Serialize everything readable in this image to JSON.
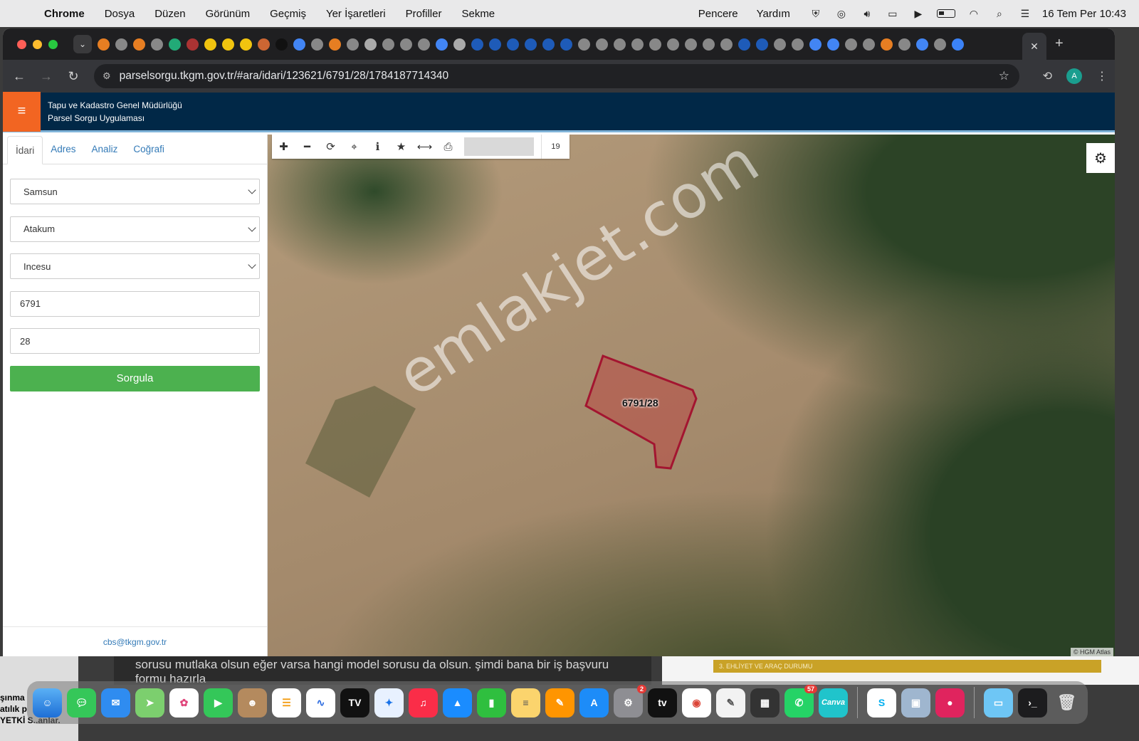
{
  "menubar": {
    "app_name": "Chrome",
    "items": [
      "Dosya",
      "Düzen",
      "Görünüm",
      "Geçmiş",
      "Yer İşaretleri",
      "Profiller",
      "Sekme"
    ],
    "right_items": [
      "Pencere",
      "Yardım"
    ],
    "clock": "16 Tem Per  10:43"
  },
  "browser": {
    "url": "parselsorgu.tkgm.gov.tr/#ara/idari/123621/6791/28/1784187714340",
    "profile_initial": "A"
  },
  "site": {
    "org_name": "Tapu ve Kadastro Genel Müdürlüğü",
    "app_name": "Parsel Sorgu Uygulaması"
  },
  "sidebar": {
    "tabs": [
      "İdari",
      "Adres",
      "Analiz",
      "Coğrafi"
    ],
    "province": "Samsun",
    "district": "Atakum",
    "neighborhood": "Incesu",
    "block_no": "6791",
    "parcel_no": "28",
    "query_button": "Sorgula",
    "contact_email": "cbs@tkgm.gov.tr"
  },
  "map": {
    "zoom_level": "19",
    "parcel_label": "6791/28",
    "watermark": "emlakjet.com",
    "attribution": "© HGM Atlas",
    "parcel_color": "#a31530"
  },
  "behind": {
    "chat_text": "sorusu mutlaka olsun eğer varsa hangi model sorusu da olsun. şimdi bana bir iş başvuru formu hazırla",
    "doc_heading": "3. EHLİYET VE ARAÇ DURUMU",
    "left_text_1": "şınma",
    "left_text_2": "atılık p",
    "left_text_3": "YETKİ S..anlar."
  },
  "dock": {
    "apps": [
      "finder",
      "messages",
      "mail",
      "maps",
      "photos",
      "facetime",
      "contacts",
      "reminders",
      "freeform",
      "tradingview",
      "safari",
      "music",
      "keynote",
      "numbers",
      "notes",
      "pages",
      "app-store",
      "system-settings",
      "apple-tv",
      "chrome",
      "textedit",
      "calculator",
      "whatsapp",
      "canva",
      "skype",
      "preview",
      "screen-recorder",
      "folder",
      "terminal",
      "trash"
    ],
    "settings_badge": "2",
    "whatsapp_badge": "57",
    "canva_label": "Canva",
    "tv_label": "tv"
  }
}
